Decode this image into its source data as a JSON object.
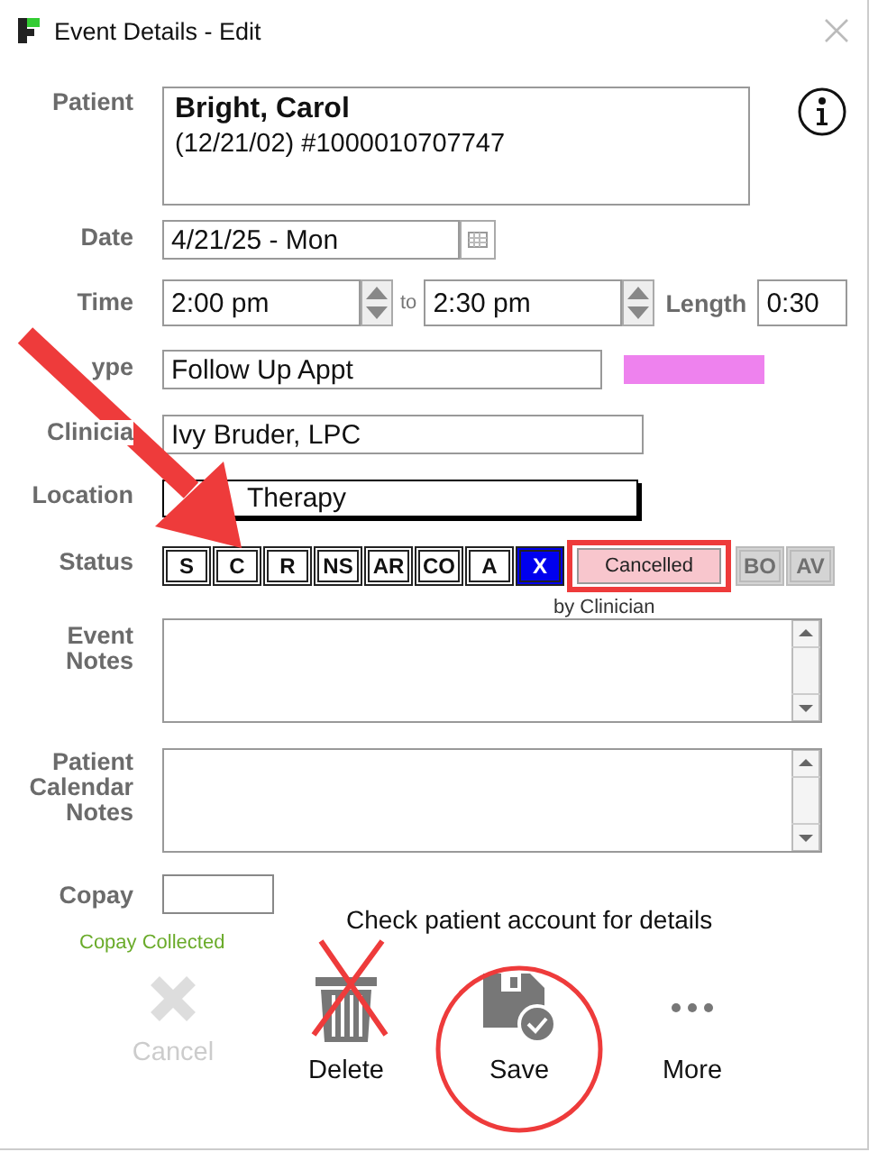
{
  "window": {
    "title": "Event Details - Edit"
  },
  "patient": {
    "label": "Patient",
    "name": "Bright, Carol",
    "details": "(12/21/02) #1000010707747"
  },
  "date": {
    "label": "Date",
    "value": "4/21/25 - Mon"
  },
  "time": {
    "label": "Time",
    "start": "2:00 pm",
    "separator": "to",
    "end": "2:30 pm",
    "length_label": "Length",
    "length": "0:30"
  },
  "type": {
    "label": "ype",
    "value": "Follow Up Appt",
    "color": "#ee82ee"
  },
  "clinician": {
    "label": "Clinicia",
    "value": "Ivy Bruder, LPC"
  },
  "location": {
    "label": "Location",
    "value": "Therapy"
  },
  "status": {
    "label": "Status",
    "buttons": [
      {
        "label": "S",
        "selected": false,
        "disabled": false
      },
      {
        "label": "C",
        "selected": false,
        "disabled": false
      },
      {
        "label": "R",
        "selected": false,
        "disabled": false
      },
      {
        "label": "NS",
        "selected": false,
        "disabled": false
      },
      {
        "label": "AR",
        "selected": false,
        "disabled": false
      },
      {
        "label": "CO",
        "selected": false,
        "disabled": false
      },
      {
        "label": "A",
        "selected": false,
        "disabled": false
      },
      {
        "label": "X",
        "selected": true,
        "disabled": false
      }
    ],
    "reason": "Cancelled",
    "by": "by Clinician",
    "extra_buttons": [
      {
        "label": "BO",
        "disabled": true
      },
      {
        "label": "AV",
        "disabled": true
      }
    ]
  },
  "event_notes": {
    "label": "Event Notes"
  },
  "calendar_notes": {
    "label": "Patient Calendar Notes"
  },
  "copay": {
    "label": "Copay",
    "collected": "Copay Collected"
  },
  "message": "Check patient account for details",
  "actions": [
    {
      "kind": "cancel",
      "label": "Cancel",
      "disabled": true
    },
    {
      "kind": "delete",
      "label": "Delete",
      "disabled": false
    },
    {
      "kind": "save",
      "label": "Save",
      "disabled": false
    },
    {
      "kind": "more",
      "label": "More",
      "disabled": false
    }
  ]
}
